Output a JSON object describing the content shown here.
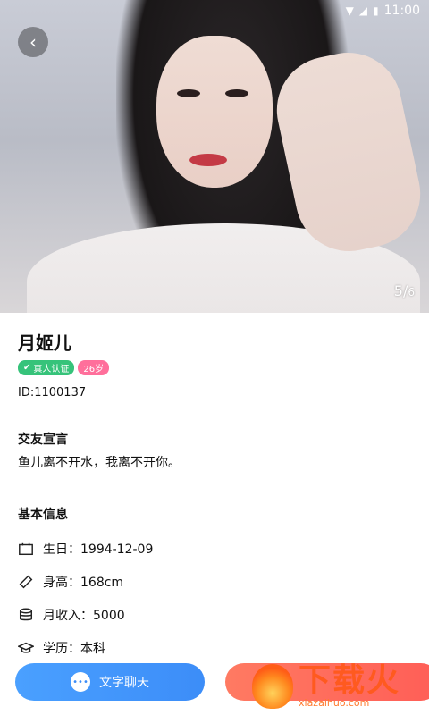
{
  "status_bar": {
    "time": "11:00"
  },
  "photo": {
    "current": "5",
    "total": "6"
  },
  "profile": {
    "name": "月姬儿",
    "verified_label": "真人认证",
    "age_label": "26岁",
    "id_text": "ID:1100137"
  },
  "motto": {
    "title": "交友宣言",
    "text": "鱼儿离不开水，我离不开你。"
  },
  "basic_info": {
    "title": "基本信息",
    "rows": [
      {
        "icon": "calendar-icon",
        "text": "生日：1994-12-09"
      },
      {
        "icon": "ruler-icon",
        "text": "身高：168cm"
      },
      {
        "icon": "coins-icon",
        "text": "月收入：5000"
      },
      {
        "icon": "graduation-cap-icon",
        "text": "学历：本科"
      }
    ]
  },
  "actions": {
    "chat_label": "文字聊天",
    "chat_icon": "chat-bubble-icon"
  },
  "watermark": {
    "cn": "下载火",
    "en": "xiazaihuo.com"
  },
  "colors": {
    "verified": "#36c37a",
    "age": "#ff6f9b",
    "chat_button": "#3c8df8",
    "call_button": "#ff5e57",
    "watermark": "#ff5a1f"
  }
}
